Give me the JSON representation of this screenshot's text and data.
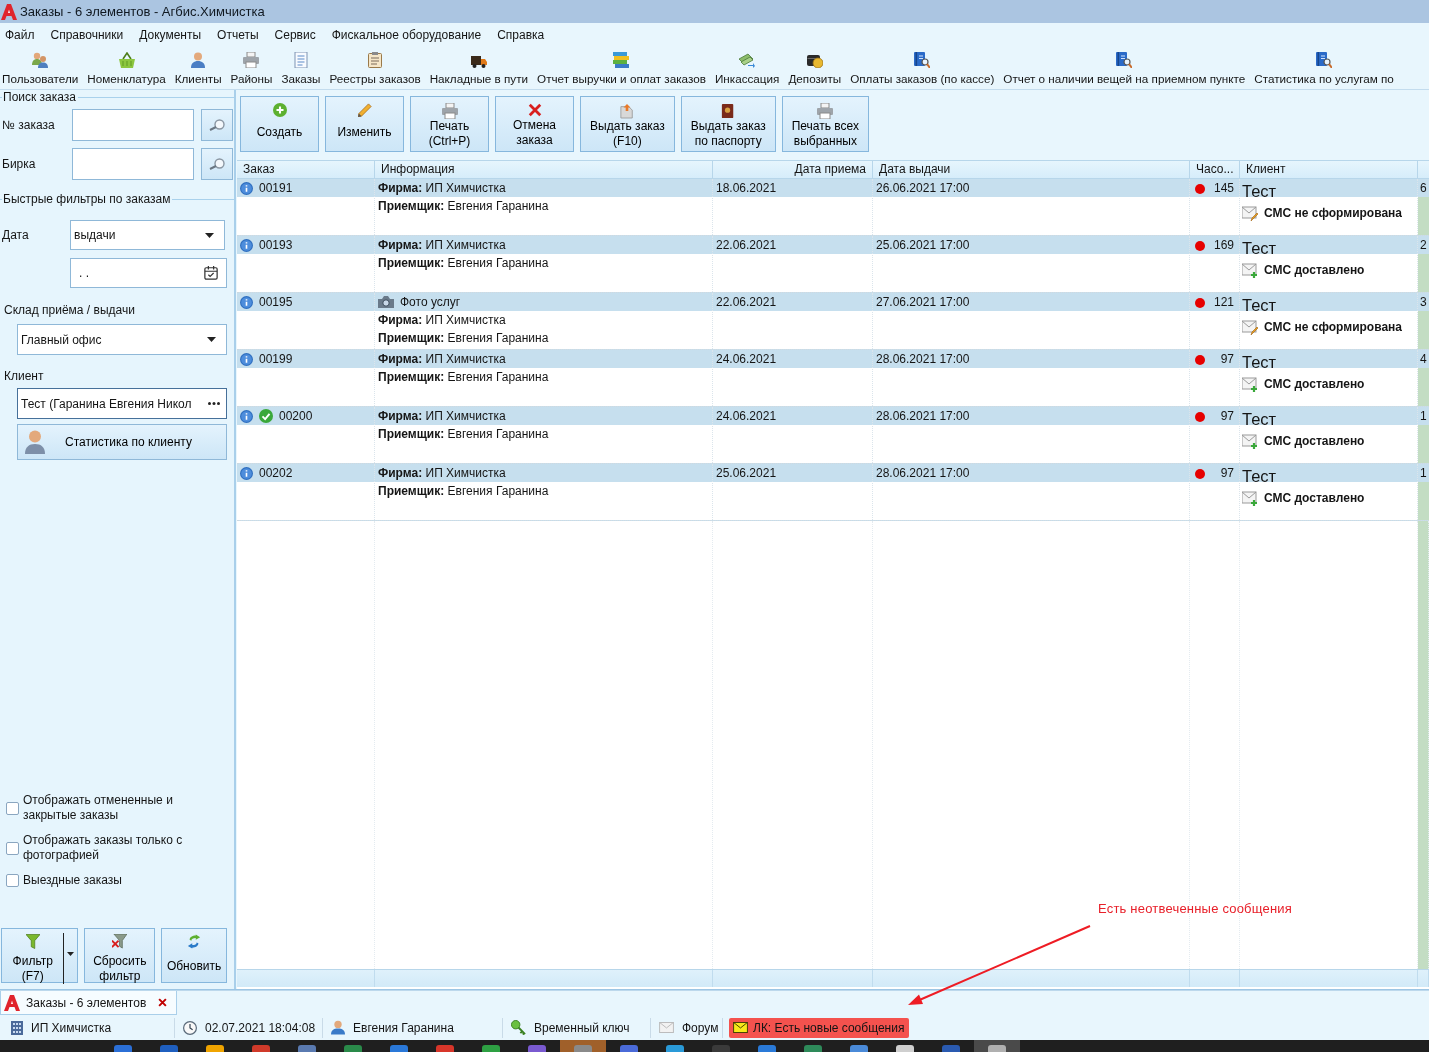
{
  "window": {
    "title": "Заказы - 6 элементов - Агбис.Химчистка"
  },
  "menu": [
    "Файл",
    "Справочники",
    "Документы",
    "Отчеты",
    "Сервис",
    "Фискальное оборудование",
    "Справка"
  ],
  "toolbar": [
    "Пользователи",
    "Номенклатура",
    "Клиенты",
    "Районы",
    "Заказы",
    "Реестры заказов",
    "Накладные в пути",
    "Отчет выручки и оплат заказов",
    "Инкассация",
    "Депозиты",
    "Оплаты заказов (по кассе)",
    "Отчет о наличии вещей на приемном пункте",
    "Статистика по услугам по"
  ],
  "search_panel": {
    "title": "Поиск заказа",
    "fields": [
      {
        "label": "№ заказа"
      },
      {
        "label": "Бирка"
      }
    ]
  },
  "filters": {
    "title": "Быстрые фильтры по заказам",
    "date": {
      "label": "Дата",
      "value": "выдачи",
      "date_value": ". ."
    },
    "warehouse": {
      "label": "Склад приёма / выдачи",
      "value": "Главный офис"
    },
    "client": {
      "label": "Клиент",
      "value": "Тест (Гаранина Евгения Никол"
    },
    "client_stats_button": "Статистика по клиенту",
    "checkboxes": [
      {
        "label": "Отображать отмененные и закрытые заказы",
        "checked": false
      },
      {
        "label": "Отображать заказы только с фотографией",
        "checked": false
      },
      {
        "label": "Выездные заказы",
        "checked": false
      }
    ],
    "buttons": [
      "Фильтр\n(F7)",
      "Сбросить\nфильтр",
      "Обновить"
    ]
  },
  "actions": [
    "Создать",
    "Изменить",
    "Печать\n(Ctrl+P)",
    "Отмена\nзаказа",
    "Выдать заказ\n(F10)",
    "Выдать заказ\nпо паспорту",
    "Печать всех\nвыбранных"
  ],
  "table": {
    "columns": [
      "Заказ",
      "Информация",
      "Дата приема",
      "Дата выдачи",
      "Часо...",
      "Клиент"
    ],
    "rows": [
      {
        "order": "00191",
        "completed": false,
        "info": [
          {
            "kind": "text",
            "text": "**Фирма:** ИП Химчистка"
          },
          {
            "kind": "text",
            "text": "**Приемщик:** Евгения Гаранина"
          }
        ],
        "received": "18.06.2021",
        "due": "26.06.2021 17:00",
        "hours": "145",
        "color": "#e60000",
        "client": "Тест",
        "sms": {
          "kind": "draft",
          "text": "СМС не сформирована"
        },
        "column_7": "6"
      },
      {
        "order": "00193",
        "completed": false,
        "info": [
          {
            "kind": "text",
            "text": "**Фирма:** ИП Химчистка"
          },
          {
            "kind": "text",
            "text": "**Приемщик:** Евгения Гаранина"
          }
        ],
        "received": "22.06.2021",
        "due": "25.06.2021 17:00",
        "hours": "169",
        "color": "#e60000",
        "client": "Тест",
        "sms": {
          "kind": "delivered",
          "text": "СМС доставлено"
        },
        "column_7": "2"
      },
      {
        "order": "00195",
        "completed": false,
        "info": [
          {
            "kind": "photo",
            "text": "Фото услуг"
          },
          {
            "kind": "text",
            "text": "**Фирма:** ИП Химчистка"
          },
          {
            "kind": "text",
            "text": "**Приемщик:** Евгения Гаранина"
          }
        ],
        "received": "22.06.2021",
        "due": "27.06.2021 17:00",
        "hours": "121",
        "color": "#e60000",
        "client": "Тест",
        "sms": {
          "kind": "draft",
          "text": "СМС не сформирована"
        },
        "column_7": "3"
      },
      {
        "order": "00199",
        "completed": false,
        "info": [
          {
            "kind": "text",
            "text": "**Фирма:** ИП Химчистка"
          },
          {
            "kind": "text",
            "text": "**Приемщик:** Евгения Гаранина"
          }
        ],
        "received": "24.06.2021",
        "due": "28.06.2021 17:00",
        "hours": "97",
        "color": "#e60000",
        "client": "Тест",
        "sms": {
          "kind": "delivered",
          "text": "СМС доставлено"
        },
        "column_7": "4"
      },
      {
        "order": "00200",
        "completed": true,
        "info": [
          {
            "kind": "text",
            "text": "**Фирма:** ИП Химчистка"
          },
          {
            "kind": "text",
            "text": "**Приемщик:** Евгения Гаранина"
          }
        ],
        "received": "24.06.2021",
        "due": "28.06.2021 17:00",
        "hours": "97",
        "color": "#e60000",
        "client": "Тест",
        "sms": {
          "kind": "delivered",
          "text": "СМС доставлено"
        },
        "column_7": "1"
      },
      {
        "order": "00202",
        "completed": false,
        "info": [
          {
            "kind": "text",
            "text": "**Фирма:** ИП Химчистка"
          },
          {
            "kind": "text",
            "text": "**Приемщик:** Евгения Гаранина"
          }
        ],
        "received": "25.06.2021",
        "due": "28.06.2021 17:00",
        "hours": "97",
        "color": "#e60000",
        "client": "Тест",
        "sms": {
          "kind": "delivered",
          "text": "СМС доставлено"
        },
        "column_7": "1"
      }
    ]
  },
  "tabs": [
    {
      "label": "Заказы - 6 элементов",
      "selected": true
    }
  ],
  "status_bar": [
    {
      "text": "ИП Химчистка",
      "alert": false
    },
    {
      "text": "02.07.2021 18:04:08",
      "alert": false
    },
    {
      "text": "Евгения Гаранина",
      "alert": false
    },
    {
      "text": "Временный ключ",
      "alert": false
    },
    {
      "text": "Форум",
      "alert": false
    },
    {
      "text": "ЛК: Есть новые сообщения",
      "alert": true
    }
  ],
  "annotation": {
    "text": "Есть неотвеченные сообщения"
  }
}
